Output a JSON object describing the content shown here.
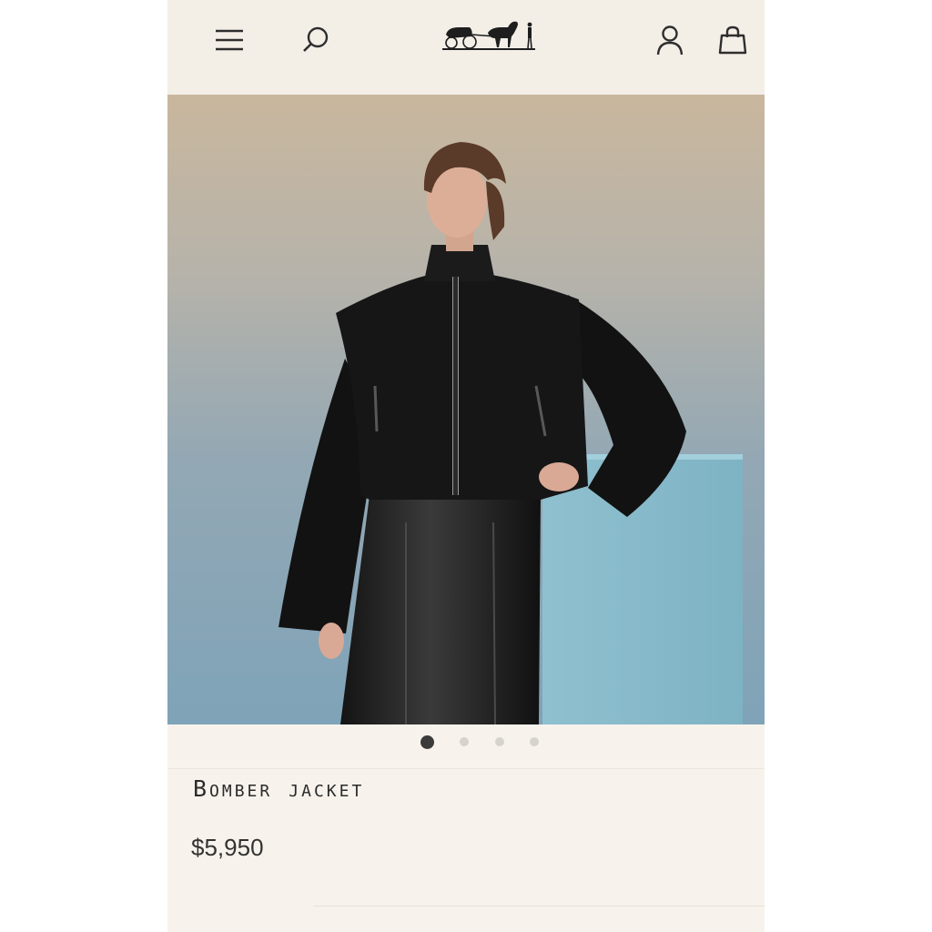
{
  "header": {
    "menu_icon": "menu-icon",
    "search_icon": "search-icon",
    "logo": "carriage-logo",
    "account_icon": "user-icon",
    "bag_icon": "shopping-bag-icon"
  },
  "hero": {
    "description_icon": "product-photo"
  },
  "carousel": {
    "total_slides": 4,
    "active_index": 0
  },
  "product": {
    "title": "Bomber jacket",
    "price": "$5,950"
  },
  "colors": {
    "page_bg": "#f7f3ec",
    "text": "#2b2b2b",
    "dot_active": "#3b3b3b",
    "dot_inactive": "#d6d3cd"
  }
}
